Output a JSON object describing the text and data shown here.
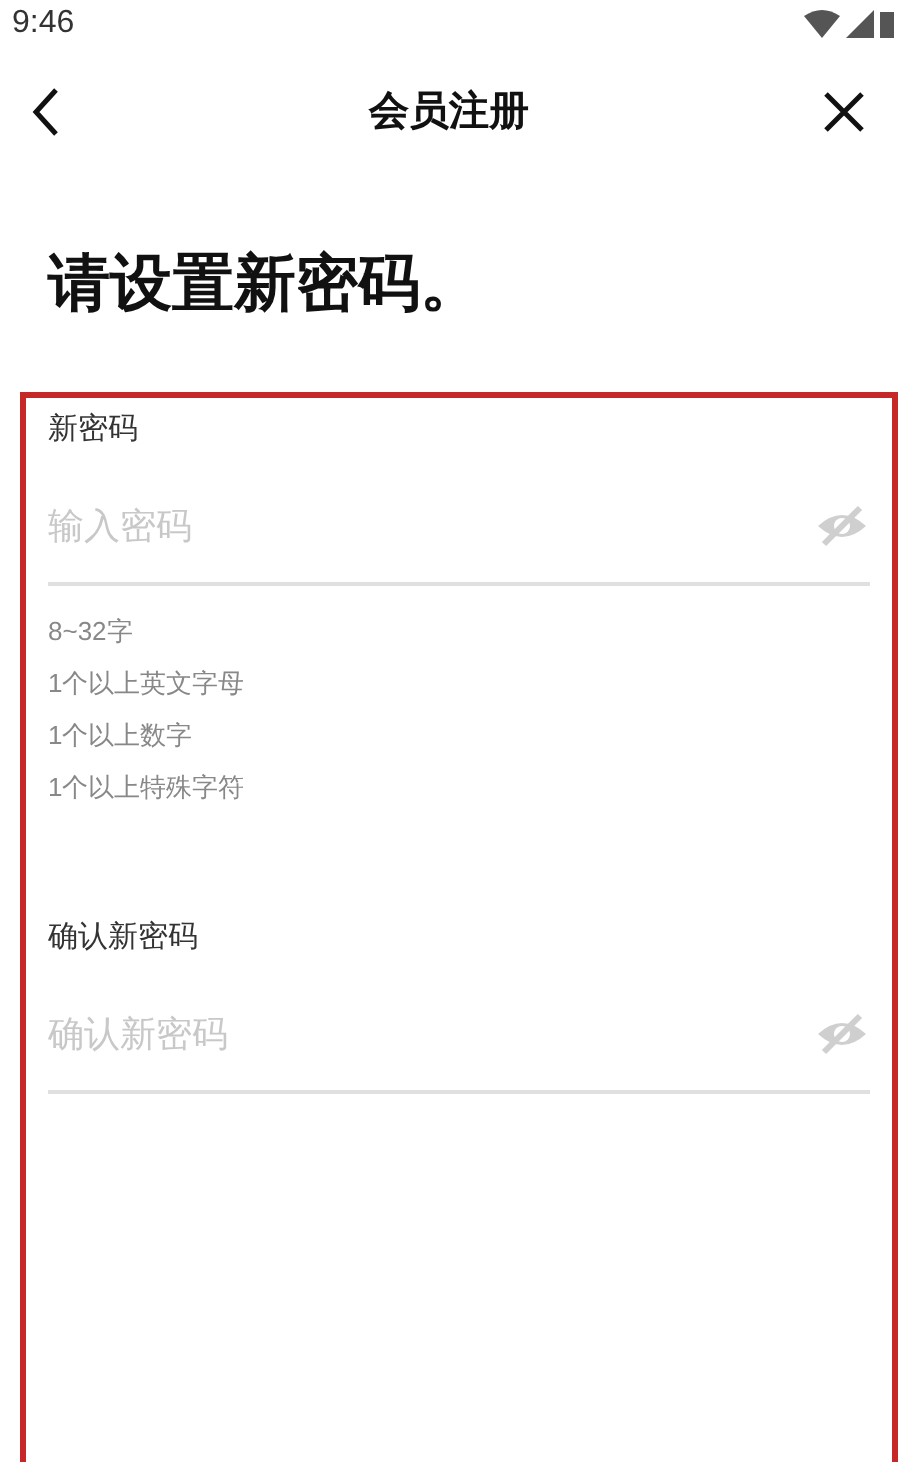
{
  "status_bar": {
    "time": "9:46"
  },
  "header": {
    "title": "会员注册"
  },
  "heading": "请设置新密码。",
  "fields": [
    {
      "label": "新密码",
      "placeholder": "输入密码",
      "rules": [
        "8~32字",
        "1个以上英文字母",
        "1个以上数字",
        "1个以上特殊字符"
      ]
    },
    {
      "label": "确认新密码",
      "placeholder": "确认新密码"
    }
  ]
}
